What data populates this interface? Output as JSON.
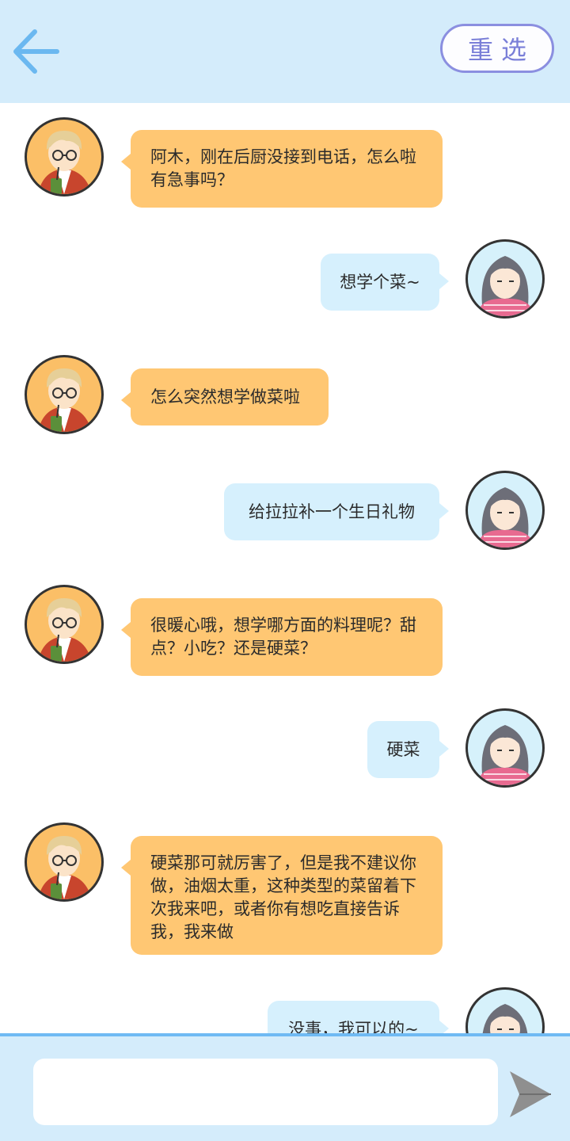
{
  "header": {
    "back_icon": "arrow-left-icon",
    "reset_label": "重选"
  },
  "messages": [
    {
      "from": "friend",
      "text": "阿木，刚在后厨没接到电话，怎么啦有急事吗？"
    },
    {
      "from": "me",
      "text": "想学个菜~"
    },
    {
      "from": "friend",
      "text": "怎么突然想学做菜啦"
    },
    {
      "from": "me",
      "text": "给拉拉补一个生日礼物"
    },
    {
      "from": "friend",
      "text": "很暖心哦，想学哪方面的料理呢？甜点？小吃？还是硬菜？"
    },
    {
      "from": "me",
      "text": "硬菜"
    },
    {
      "from": "friend",
      "text": "硬菜那可就厉害了，但是我不建议你做，油烟太重，这种类型的菜留着下次我来吧，或者你有想吃直接告诉我，我来做"
    },
    {
      "from": "me",
      "text": "没事，我可以的~"
    }
  ],
  "composer": {
    "input_value": "",
    "send_icon": "send-icon"
  },
  "colors": {
    "header_bg": "#d4ecfb",
    "friend_bubble": "#ffc773",
    "me_bubble": "#d6f0fd",
    "accent": "#6fbaf3",
    "reset_border": "#8b8fe0"
  }
}
